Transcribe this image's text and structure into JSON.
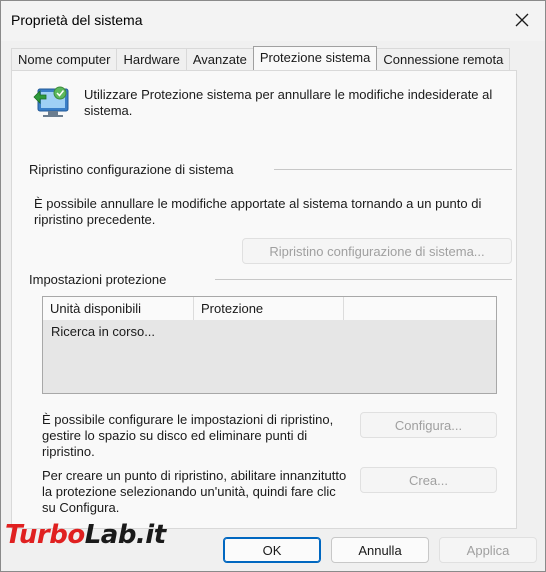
{
  "window": {
    "title": "Proprietà del sistema"
  },
  "tabs": [
    {
      "label": "Nome computer",
      "active": false
    },
    {
      "label": "Hardware",
      "active": false
    },
    {
      "label": "Avanzate",
      "active": false
    },
    {
      "label": "Protezione sistema",
      "active": true
    },
    {
      "label": "Connessione remota",
      "active": false
    }
  ],
  "intro": {
    "text": "Utilizzare Protezione sistema per annullare le modifiche indesiderate al sistema."
  },
  "restore": {
    "group_label": "Ripristino configurazione di sistema",
    "description": "È possibile annullare le modifiche apportate al sistema tornando a un punto di ripristino precedente.",
    "button_label": "Ripristino configurazione di sistema..."
  },
  "protection": {
    "group_label": "Impostazioni protezione",
    "columns": [
      "Unità disponibili",
      "Protezione",
      ""
    ],
    "status": "Ricerca in corso...",
    "configure_text": "È possibile configurare le impostazioni di ripristino, gestire lo spazio su disco ed eliminare punti di ripristino.",
    "configure_button": "Configura...",
    "create_text": "Per creare un punto di ripristino, abilitare innanzitutto la protezione selezionando un'unità, quindi fare clic su Configura.",
    "create_button": "Crea..."
  },
  "footer": {
    "ok": "OK",
    "cancel": "Annulla",
    "apply": "Applica"
  },
  "watermark": {
    "part1": "Turbo",
    "part2": "Lab.it"
  },
  "colors": {
    "accent": "#0067c0",
    "disabled_text": "#a0a0a0",
    "watermark_red": "#e02020"
  },
  "icons": {
    "close": "close-icon",
    "system_protection": "system-protection-icon"
  }
}
